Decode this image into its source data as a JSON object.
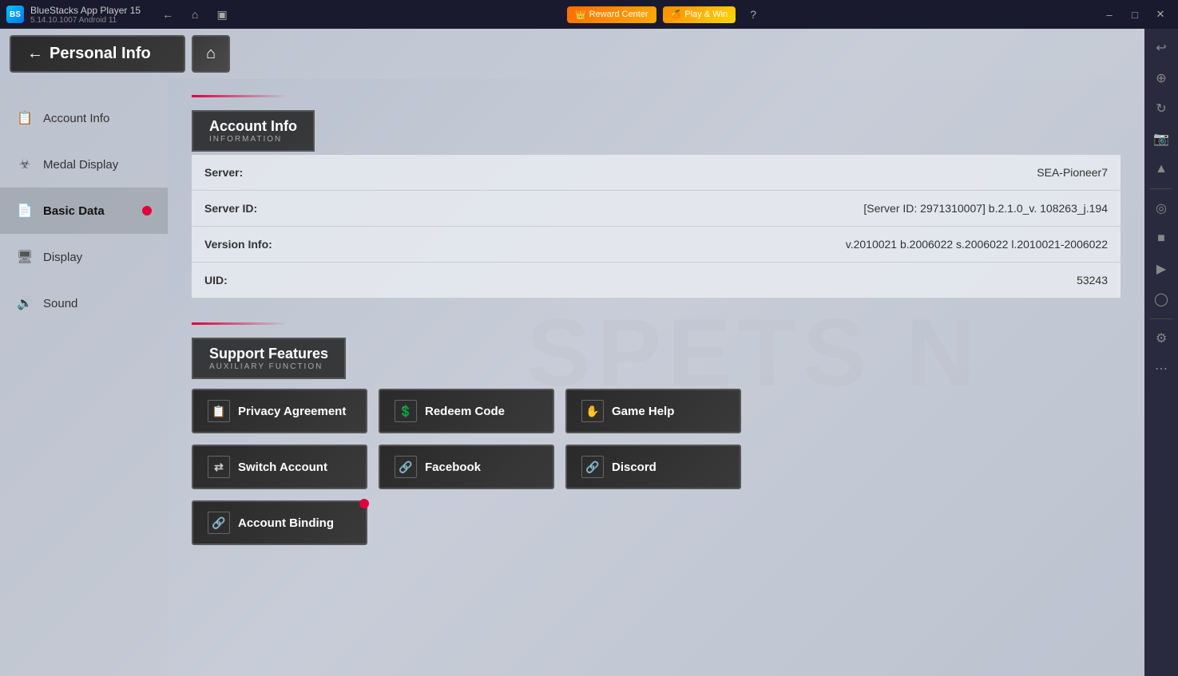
{
  "titlebar": {
    "app_name": "BlueStacks App Player 15",
    "app_version": "5.14.10.1007  Android 11",
    "reward_center": "Reward Center",
    "play_and_win": "Play & Win"
  },
  "topbar": {
    "personal_info": "Personal Info",
    "home_icon": "🏠"
  },
  "sidebar": {
    "items": [
      {
        "id": "account-info",
        "label": "Account Info",
        "icon": "📋",
        "active": false,
        "badge": false
      },
      {
        "id": "medal-display",
        "label": "Medal Display",
        "icon": "🏅",
        "active": false,
        "badge": false
      },
      {
        "id": "basic-data",
        "label": "Basic Data",
        "icon": "📄",
        "active": true,
        "badge": true
      },
      {
        "id": "display",
        "label": "Display",
        "icon": "🖥",
        "active": false,
        "badge": false
      },
      {
        "id": "sound",
        "label": "Sound",
        "icon": "🔊",
        "active": false,
        "badge": false
      }
    ]
  },
  "account_info": {
    "section_title": "Account Info",
    "section_subtitle": "INFORMATION",
    "rows": [
      {
        "label": "Server:",
        "value": "SEA-Pioneer7"
      },
      {
        "label": "Server ID:",
        "value": "[Server ID: 2971310007] b.2.1.0_v. 108263_j.194"
      },
      {
        "label": "Version Info:",
        "value": "v.2010021 b.2006022 s.2006022 l.2010021-2006022"
      },
      {
        "label": "UID:",
        "value": "53243"
      }
    ]
  },
  "support_features": {
    "section_title": "Support Features",
    "section_subtitle": "AUXILIARY FUNCTION",
    "buttons": [
      {
        "id": "privacy-agreement",
        "label": "Privacy Agreement",
        "icon": "📋",
        "badge": false
      },
      {
        "id": "redeem-code",
        "label": "Redeem Code",
        "icon": "💰",
        "badge": false
      },
      {
        "id": "game-help",
        "label": "Game Help",
        "icon": "✋",
        "badge": false
      },
      {
        "id": "switch-account",
        "label": "Switch Account",
        "icon": "🔄",
        "badge": false
      },
      {
        "id": "facebook",
        "label": "Facebook",
        "icon": "🔗",
        "badge": false
      },
      {
        "id": "discord",
        "label": "Discord",
        "icon": "🔗",
        "badge": false
      },
      {
        "id": "account-binding",
        "label": "Account Binding",
        "icon": "🔗",
        "badge": true
      }
    ]
  },
  "bg_watermark": "SPETS N",
  "right_sidebar_buttons": [
    "↩",
    "⊕",
    "⟳",
    "📷",
    "↑",
    "🎯",
    "⬛",
    "▶",
    "🔵",
    "⚙",
    "…"
  ]
}
